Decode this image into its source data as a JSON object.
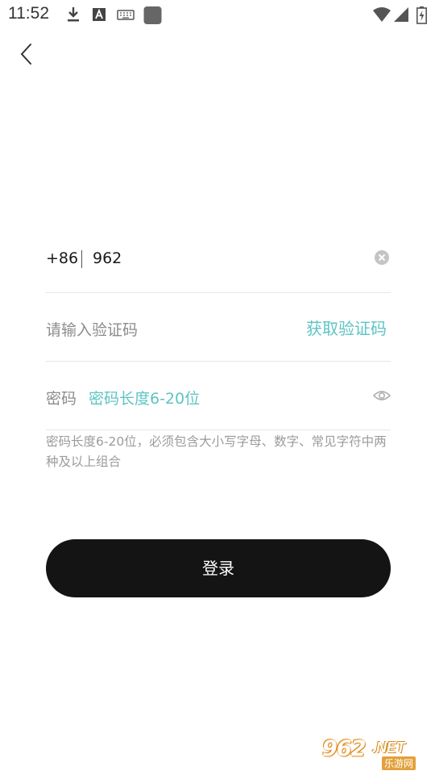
{
  "status_bar": {
    "time": "11:52",
    "icons": [
      "download-icon",
      "font-a-icon",
      "keyboard-icon",
      "app-square-icon",
      "wifi-icon",
      "signal-icon",
      "battery-charging-icon"
    ]
  },
  "nav": {
    "back_icon": "chevron-left-icon"
  },
  "phone": {
    "country_code": "+86",
    "value": "962",
    "clear_icon": "clear-circle-icon"
  },
  "verify": {
    "placeholder": "请输入验证码",
    "get_code_label": "获取验证码"
  },
  "password": {
    "label": "密码",
    "placeholder": "密码长度6-20位",
    "toggle_icon": "eye-icon"
  },
  "hint_text": "密码长度6-20位，必须包含大小写字母、数字、常见字符中两种及以上组合",
  "login_button": "登录",
  "watermark": {
    "main": "962",
    "net": ".NET",
    "sub": "乐游网"
  },
  "colors": {
    "accent": "#5ec4c4",
    "button_bg": "#141414",
    "hint": "#8c8c8c"
  }
}
